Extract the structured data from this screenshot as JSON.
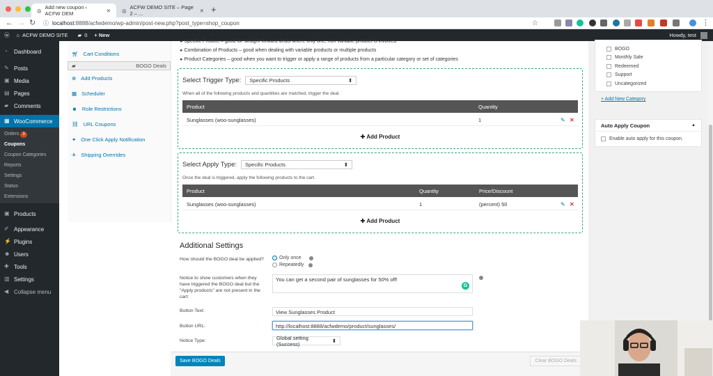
{
  "browser": {
    "tabs": [
      {
        "title": "Add new coupon ‹ ACFW DEM",
        "active": true
      },
      {
        "title": "ACFW DEMO SITE – Page 2 – ...",
        "active": false
      }
    ],
    "url_host": "localhost",
    "url_rest": ":8888/acfwdemo/wp-admin/post-new.php?post_type=shop_coupon"
  },
  "adminbar": {
    "site": "ACFW DEMO SITE",
    "comments": "0",
    "new": "+ New",
    "howdy": "Howdy, test"
  },
  "sidebar": {
    "items": [
      {
        "label": "Dashboard",
        "icon": "dashboard-icon"
      },
      {
        "label": "Posts",
        "icon": "pin-icon"
      },
      {
        "label": "Media",
        "icon": "media-icon"
      },
      {
        "label": "Pages",
        "icon": "page-icon"
      },
      {
        "label": "Comments",
        "icon": "comment-icon"
      },
      {
        "label": "WooCommerce",
        "icon": "woo-icon"
      }
    ],
    "woo_sub": [
      "Orders",
      "Coupons",
      "Coupon Categories",
      "Reports",
      "Settings",
      "Status",
      "Extensions"
    ],
    "orders_badge": "3",
    "items2": [
      {
        "label": "Products",
        "icon": "box-icon"
      },
      {
        "label": "Appearance",
        "icon": "brush-icon"
      },
      {
        "label": "Plugins",
        "icon": "plug-icon"
      },
      {
        "label": "Users",
        "icon": "user-icon"
      },
      {
        "label": "Tools",
        "icon": "wrench-icon"
      },
      {
        "label": "Settings",
        "icon": "sliders-icon"
      },
      {
        "label": "Collapse menu",
        "icon": "collapse-icon"
      }
    ]
  },
  "coupon_tabs": [
    "Cart Conditions",
    "BOGO Deals",
    "Add Products",
    "Scheduler",
    "Role Restrictions",
    "URL Coupons",
    "One Click Apply Notification",
    "Shipping Overrides"
  ],
  "bullets": [
    "Specific Product – good for straight forward deals where only one, non-variable product is involved",
    "Combination of Products – good when dealing with variable products or multiple products",
    "Product Categories – good when you want to trigger or apply a range of products from a particular category or set of categories"
  ],
  "trigger": {
    "label": "Select Trigger Type:",
    "value": "Specific Products",
    "help": "When all of the following products and quantities are matched, trigger the deal.",
    "col_product": "Product",
    "col_qty": "Quantity",
    "row_product": "Sunglasses (woo-sunglasses)",
    "row_qty": "1",
    "add": "Add Product"
  },
  "apply": {
    "label": "Select Apply Type:",
    "value": "Specific Products",
    "help": "Once the deal is triggered, apply the following products to the cart.",
    "col_product": "Product",
    "col_qty": "Quantity",
    "col_price": "Price/Discount",
    "row_product": "Sunglasses (woo-sunglasses)",
    "row_qty": "1",
    "row_price": "(percent) 50",
    "add": "Add Product"
  },
  "settings": {
    "title": "Additional Settings",
    "q1": "How should the BOGO deal be applied?",
    "opt1": "Only once",
    "opt2": "Repeatedly",
    "notice_label": "Notice to show customers when they have triggered the BOGO deal but the \"Apply products\" are not present in the cart:",
    "notice_value": "You can get a second pair of sunglasses for 50% off!",
    "btn_text_label": "Button Text:",
    "btn_text_value": "View Sunglasses Product",
    "btn_url_label": "Button URL:",
    "btn_url_value": "http://localhost:8888/acfwdemo/product/sunglasses/",
    "notice_type_label": "Notice Type:",
    "notice_type_value": "Global setting (Success)"
  },
  "footer": {
    "save": "Save BOGO Deals",
    "clear": "Clear BOGO Deals"
  },
  "categories": {
    "items": [
      "BOGO",
      "Monthly Sale",
      "Redeemed",
      "Support",
      "Uncategorized"
    ],
    "add_new": "+ Add New Category"
  },
  "auto_apply": {
    "title": "Auto Apply Coupon",
    "label": "Enable auto apply for this coupon."
  },
  "colors": {
    "wp_blue": "#0073aa",
    "admin_dark": "#23282d",
    "dashed_green": "#3aa183",
    "danger": "#dc3232"
  }
}
